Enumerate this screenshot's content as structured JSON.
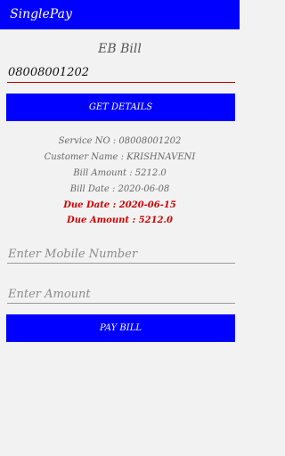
{
  "app": {
    "title": "SinglePay"
  },
  "screen": {
    "title": "EB Bill"
  },
  "service_input": {
    "value": "08008001202"
  },
  "get_details_button": {
    "label": "GET DETAILS"
  },
  "details": {
    "service_no": "Service NO : 08008001202",
    "customer_name": "Customer Name : KRISHNAVENI",
    "bill_amount": "Bill Amount : 5212.0",
    "bill_date": "Bill Date : 2020-06-08",
    "due_date": "Due Date : 2020-06-15",
    "due_amount": "Due Amount : 5212.0"
  },
  "mobile_input": {
    "placeholder": "Enter Mobile Number",
    "value": ""
  },
  "amount_input": {
    "placeholder": "Enter Amount",
    "value": ""
  },
  "pay_bill_button": {
    "label": "PAY BILL"
  },
  "colors": {
    "accent": "#0000ff",
    "due_text": "#d00000",
    "focus_underline": "#b20000",
    "background": "#f2f2f2"
  }
}
